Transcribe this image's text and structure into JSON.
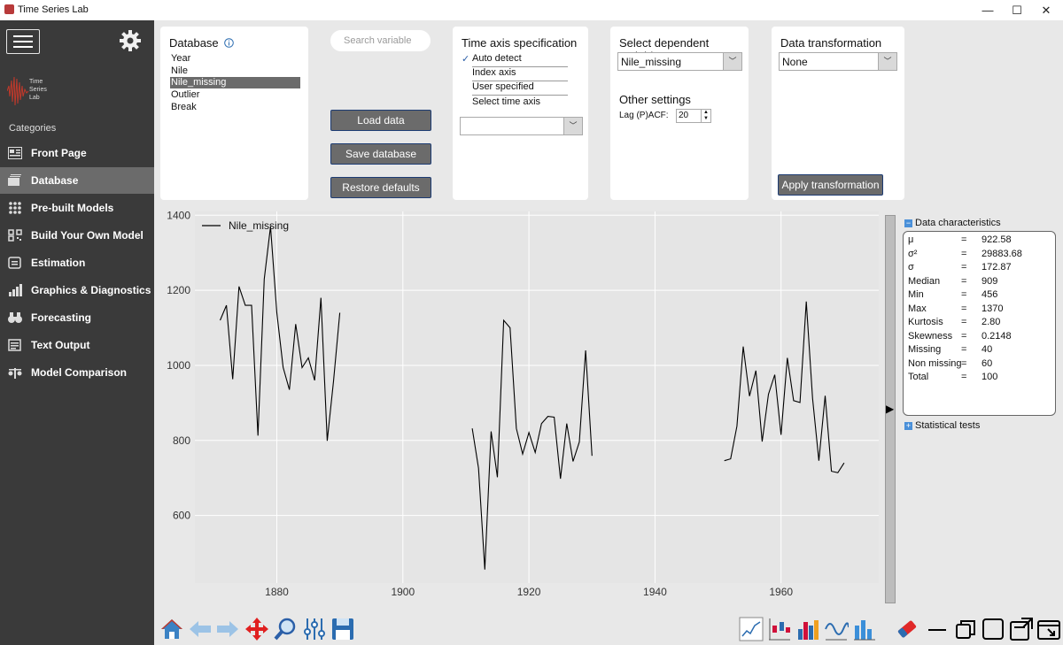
{
  "window": {
    "title": "Time Series Lab",
    "minimize": "—",
    "maximize": "☐",
    "close": "✕"
  },
  "sidebar": {
    "logo_text": [
      "Time",
      "Series",
      "Lab"
    ],
    "categories_label": "Categories",
    "items": [
      {
        "label": "Front Page",
        "icon": "front-page-icon",
        "active": false
      },
      {
        "label": "Database",
        "icon": "database-icon",
        "active": true
      },
      {
        "label": "Pre-built Models",
        "icon": "grid-icon",
        "active": false
      },
      {
        "label": "Build Your Own Model",
        "icon": "qr-icon",
        "active": false
      },
      {
        "label": "Estimation",
        "icon": "estimation-icon",
        "active": false
      },
      {
        "label": "Graphics & Diagnostics",
        "icon": "bar-chart-icon",
        "active": false
      },
      {
        "label": "Forecasting",
        "icon": "binoculars-icon",
        "active": false
      },
      {
        "label": "Text Output",
        "icon": "text-output-icon",
        "active": false
      },
      {
        "label": "Model Comparison",
        "icon": "compare-icon",
        "active": false
      }
    ]
  },
  "database": {
    "title": "Database",
    "items": [
      "Year",
      "Nile",
      "Nile_missing",
      "Outlier",
      "Break"
    ],
    "selected": "Nile_missing"
  },
  "search": {
    "placeholder": "Search variable"
  },
  "buttons": {
    "load": "Load data",
    "save": "Save database",
    "restore": "Restore defaults",
    "apply": "Apply transformation"
  },
  "time_axis": {
    "title": "Time axis specification",
    "options": [
      "Auto detect",
      "Index axis",
      "User specified",
      "Select time axis"
    ],
    "checked": "Auto detect",
    "combo_value": ""
  },
  "dependent": {
    "title": "Select dependent variable",
    "value": "Nile_missing",
    "other_title": "Other settings",
    "lag_label": "Lag (P)ACF:",
    "lag_value": "20"
  },
  "transformation": {
    "title": "Data transformation",
    "value": "None"
  },
  "data_characteristics": {
    "title": "Data characteristics",
    "rows": [
      {
        "k": "μ",
        "v": "922.58"
      },
      {
        "k": "σ²",
        "v": "29883.68"
      },
      {
        "k": "σ",
        "v": "172.87"
      },
      {
        "k": "Median",
        "v": "909"
      },
      {
        "k": "Min",
        "v": "456"
      },
      {
        "k": "Max",
        "v": "1370"
      },
      {
        "k": "Kurtosis",
        "v": "2.80"
      },
      {
        "k": "Skewness",
        "v": "0.2148"
      },
      {
        "k": "Missing",
        "v": "40"
      },
      {
        "k": "Non missing",
        "v": "60"
      },
      {
        "k": "Total",
        "v": "100"
      }
    ],
    "eq": "="
  },
  "statistical_tests": {
    "title": "Statistical tests"
  },
  "chart_data": {
    "type": "line",
    "series": [
      {
        "name": "Nile_missing",
        "color": "#000000"
      }
    ],
    "x_ticks": [
      1880,
      1900,
      1920,
      1940,
      1960
    ],
    "y_ticks": [
      600,
      800,
      1000,
      1200,
      1400
    ],
    "xlim": [
      1867,
      1975.5
    ],
    "ylim": [
      420,
      1410
    ],
    "grid": true,
    "legend": "top-left",
    "background": "#e5e5e5",
    "segments": [
      {
        "x_start": 1871,
        "values": [
          1120,
          1160,
          963,
          1210,
          1160,
          1160,
          813,
          1230,
          1370,
          1140,
          995,
          935,
          1110,
          994,
          1020,
          960,
          1180,
          799,
          958,
          1140
        ]
      },
      {
        "x_start": 1911,
        "values": [
          832,
          726,
          456,
          824,
          702,
          1120,
          1100,
          832,
          764,
          821,
          768,
          845,
          864,
          862,
          698,
          845,
          744,
          796,
          1040,
          759
        ]
      },
      {
        "x_start": 1951,
        "values": [
          746,
          751,
          838,
          1050,
          918,
          986,
          797,
          923,
          975,
          815,
          1020,
          906,
          901,
          1170,
          912,
          746,
          919,
          718,
          714,
          740
        ]
      }
    ]
  },
  "toolbar_left": [
    "home-icon",
    "back-arrow-icon",
    "forward-arrow-icon",
    "pan-icon",
    "zoom-icon",
    "adjust-icon",
    "save-icon"
  ],
  "toolbar_right": [
    "line-plot-icon",
    "candle-icon",
    "histogram-icon",
    "wave-icon",
    "bar-icon",
    "eraser-icon",
    "minimize-panel-icon",
    "restore-panel-icon",
    "maximize-panel-icon",
    "export-icon",
    "fullscreen-icon"
  ]
}
